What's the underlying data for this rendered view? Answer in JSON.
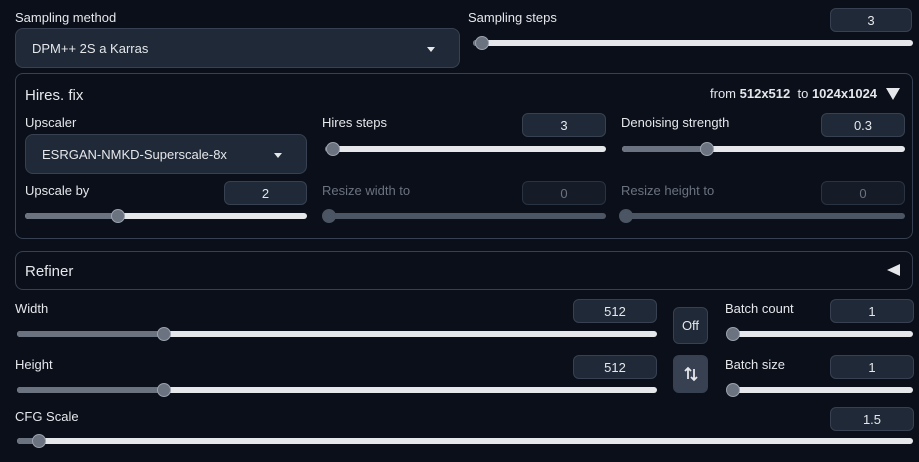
{
  "sampling": {
    "method_label": "Sampling method",
    "method_value": "DPM++ 2S a Karras",
    "steps_label": "Sampling steps",
    "steps_value": "3",
    "steps_fraction": 0.02
  },
  "hires": {
    "title": "Hires. fix",
    "from_prefix": "from",
    "from_size": "512x512",
    "to_prefix": "to",
    "to_size": "1024x1024",
    "upscaler_label": "Upscaler",
    "upscaler_value": "ESRGAN-NMKD-Superscale-8x",
    "hires_steps_label": "Hires steps",
    "hires_steps_value": "3",
    "hires_steps_fraction": 0.03,
    "denoise_label": "Denoising strength",
    "denoise_value": "0.3",
    "denoise_fraction": 0.3,
    "upscale_by_label": "Upscale by",
    "upscale_by_value": "2",
    "upscale_by_fraction": 0.33,
    "resize_width_label": "Resize width to",
    "resize_width_value": "0",
    "resize_height_label": "Resize height to",
    "resize_height_value": "0"
  },
  "refiner": {
    "title": "Refiner"
  },
  "dims": {
    "width_label": "Width",
    "width_value": "512",
    "width_fraction": 0.23,
    "height_label": "Height",
    "height_value": "512",
    "height_fraction": 0.23,
    "off_label": "Off",
    "swap_icon": "swap-vertical-icon"
  },
  "batch": {
    "count_label": "Batch count",
    "count_value": "1",
    "size_label": "Batch size",
    "size_value": "1"
  },
  "cfg": {
    "label": "CFG Scale",
    "value": "1.5",
    "fraction": 0.024
  },
  "colors": {
    "background": "#0b0f19",
    "surface": "#1f2937",
    "border": "#374151",
    "track": "#e5e7eb",
    "thumb": "#6b7280"
  }
}
